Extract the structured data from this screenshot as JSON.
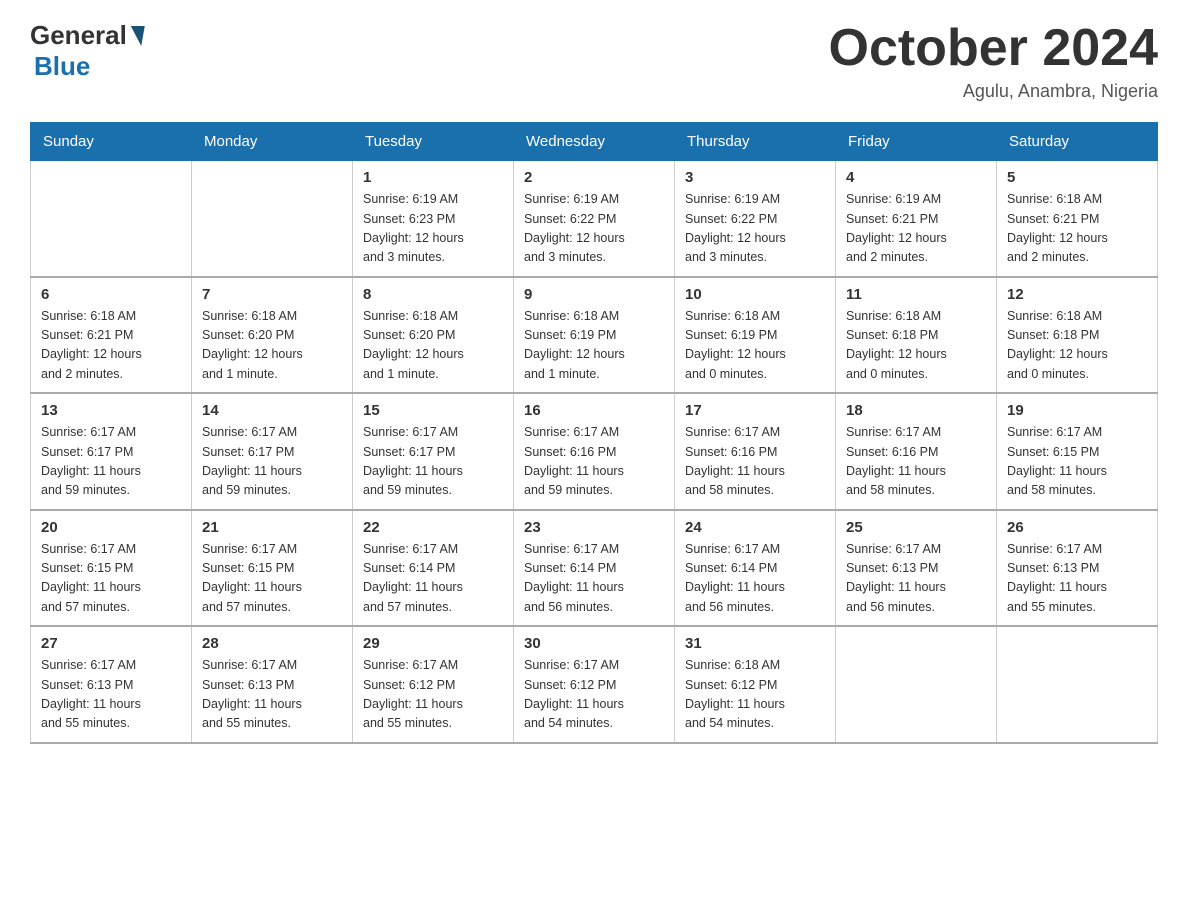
{
  "header": {
    "logo_general": "General",
    "logo_blue": "Blue",
    "month_title": "October 2024",
    "location": "Agulu, Anambra, Nigeria"
  },
  "days_of_week": [
    "Sunday",
    "Monday",
    "Tuesday",
    "Wednesday",
    "Thursday",
    "Friday",
    "Saturday"
  ],
  "weeks": [
    [
      {
        "day": "",
        "info": ""
      },
      {
        "day": "",
        "info": ""
      },
      {
        "day": "1",
        "info": "Sunrise: 6:19 AM\nSunset: 6:23 PM\nDaylight: 12 hours\nand 3 minutes."
      },
      {
        "day": "2",
        "info": "Sunrise: 6:19 AM\nSunset: 6:22 PM\nDaylight: 12 hours\nand 3 minutes."
      },
      {
        "day": "3",
        "info": "Sunrise: 6:19 AM\nSunset: 6:22 PM\nDaylight: 12 hours\nand 3 minutes."
      },
      {
        "day": "4",
        "info": "Sunrise: 6:19 AM\nSunset: 6:21 PM\nDaylight: 12 hours\nand 2 minutes."
      },
      {
        "day": "5",
        "info": "Sunrise: 6:18 AM\nSunset: 6:21 PM\nDaylight: 12 hours\nand 2 minutes."
      }
    ],
    [
      {
        "day": "6",
        "info": "Sunrise: 6:18 AM\nSunset: 6:21 PM\nDaylight: 12 hours\nand 2 minutes."
      },
      {
        "day": "7",
        "info": "Sunrise: 6:18 AM\nSunset: 6:20 PM\nDaylight: 12 hours\nand 1 minute."
      },
      {
        "day": "8",
        "info": "Sunrise: 6:18 AM\nSunset: 6:20 PM\nDaylight: 12 hours\nand 1 minute."
      },
      {
        "day": "9",
        "info": "Sunrise: 6:18 AM\nSunset: 6:19 PM\nDaylight: 12 hours\nand 1 minute."
      },
      {
        "day": "10",
        "info": "Sunrise: 6:18 AM\nSunset: 6:19 PM\nDaylight: 12 hours\nand 0 minutes."
      },
      {
        "day": "11",
        "info": "Sunrise: 6:18 AM\nSunset: 6:18 PM\nDaylight: 12 hours\nand 0 minutes."
      },
      {
        "day": "12",
        "info": "Sunrise: 6:18 AM\nSunset: 6:18 PM\nDaylight: 12 hours\nand 0 minutes."
      }
    ],
    [
      {
        "day": "13",
        "info": "Sunrise: 6:17 AM\nSunset: 6:17 PM\nDaylight: 11 hours\nand 59 minutes."
      },
      {
        "day": "14",
        "info": "Sunrise: 6:17 AM\nSunset: 6:17 PM\nDaylight: 11 hours\nand 59 minutes."
      },
      {
        "day": "15",
        "info": "Sunrise: 6:17 AM\nSunset: 6:17 PM\nDaylight: 11 hours\nand 59 minutes."
      },
      {
        "day": "16",
        "info": "Sunrise: 6:17 AM\nSunset: 6:16 PM\nDaylight: 11 hours\nand 59 minutes."
      },
      {
        "day": "17",
        "info": "Sunrise: 6:17 AM\nSunset: 6:16 PM\nDaylight: 11 hours\nand 58 minutes."
      },
      {
        "day": "18",
        "info": "Sunrise: 6:17 AM\nSunset: 6:16 PM\nDaylight: 11 hours\nand 58 minutes."
      },
      {
        "day": "19",
        "info": "Sunrise: 6:17 AM\nSunset: 6:15 PM\nDaylight: 11 hours\nand 58 minutes."
      }
    ],
    [
      {
        "day": "20",
        "info": "Sunrise: 6:17 AM\nSunset: 6:15 PM\nDaylight: 11 hours\nand 57 minutes."
      },
      {
        "day": "21",
        "info": "Sunrise: 6:17 AM\nSunset: 6:15 PM\nDaylight: 11 hours\nand 57 minutes."
      },
      {
        "day": "22",
        "info": "Sunrise: 6:17 AM\nSunset: 6:14 PM\nDaylight: 11 hours\nand 57 minutes."
      },
      {
        "day": "23",
        "info": "Sunrise: 6:17 AM\nSunset: 6:14 PM\nDaylight: 11 hours\nand 56 minutes."
      },
      {
        "day": "24",
        "info": "Sunrise: 6:17 AM\nSunset: 6:14 PM\nDaylight: 11 hours\nand 56 minutes."
      },
      {
        "day": "25",
        "info": "Sunrise: 6:17 AM\nSunset: 6:13 PM\nDaylight: 11 hours\nand 56 minutes."
      },
      {
        "day": "26",
        "info": "Sunrise: 6:17 AM\nSunset: 6:13 PM\nDaylight: 11 hours\nand 55 minutes."
      }
    ],
    [
      {
        "day": "27",
        "info": "Sunrise: 6:17 AM\nSunset: 6:13 PM\nDaylight: 11 hours\nand 55 minutes."
      },
      {
        "day": "28",
        "info": "Sunrise: 6:17 AM\nSunset: 6:13 PM\nDaylight: 11 hours\nand 55 minutes."
      },
      {
        "day": "29",
        "info": "Sunrise: 6:17 AM\nSunset: 6:12 PM\nDaylight: 11 hours\nand 55 minutes."
      },
      {
        "day": "30",
        "info": "Sunrise: 6:17 AM\nSunset: 6:12 PM\nDaylight: 11 hours\nand 54 minutes."
      },
      {
        "day": "31",
        "info": "Sunrise: 6:18 AM\nSunset: 6:12 PM\nDaylight: 11 hours\nand 54 minutes."
      },
      {
        "day": "",
        "info": ""
      },
      {
        "day": "",
        "info": ""
      }
    ]
  ]
}
